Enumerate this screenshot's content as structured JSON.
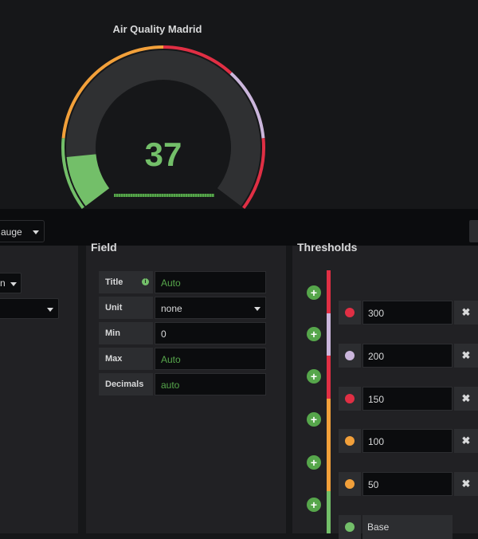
{
  "panel": {
    "title": "Air Quality Madrid",
    "value": "37"
  },
  "gauge": {
    "min": 0,
    "max": 300,
    "value": 37,
    "colors": {
      "green": "#73bf69",
      "orange": "#f2a03a",
      "red": "#e02f44",
      "lavender": "#cbb6dc",
      "track": "#2f3032"
    }
  },
  "toolbar": {
    "visualization": "auge"
  },
  "left": {
    "select1": "n"
  },
  "field": {
    "header": "Field",
    "rows": [
      {
        "label": "Title",
        "value": "Auto"
      },
      {
        "label": "Unit",
        "value": "none"
      },
      {
        "label": "Min",
        "value": "0"
      },
      {
        "label": "Max",
        "value": "Auto"
      },
      {
        "label": "Decimals",
        "value": "auto"
      }
    ]
  },
  "thresholds": {
    "header": "Thresholds",
    "add_icon": "+",
    "remove_icon": "✖",
    "items": [
      {
        "value": "300",
        "color": "#e02f44"
      },
      {
        "value": "200",
        "color": "#cbb6dc"
      },
      {
        "value": "150",
        "color": "#e02f44"
      },
      {
        "value": "100",
        "color": "#f2a03a"
      },
      {
        "value": "50",
        "color": "#f2a03a"
      },
      {
        "value": "Base",
        "color": "#73bf69"
      }
    ]
  }
}
